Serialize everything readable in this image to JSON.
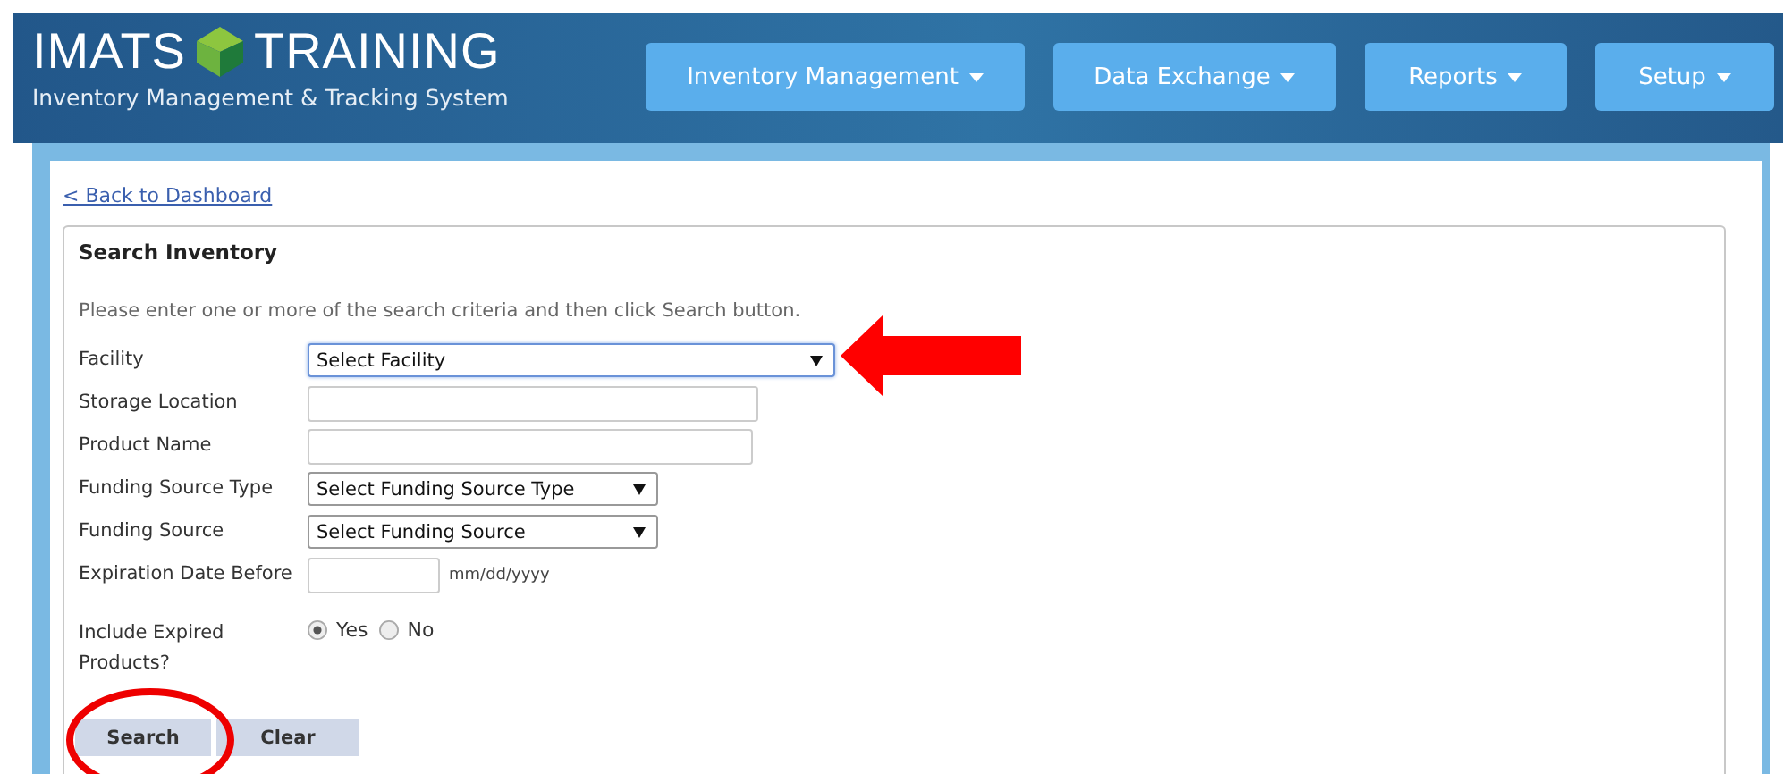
{
  "header": {
    "title_left": "IMATS",
    "title_right": "TRAINING",
    "subtitle": "Inventory Management & Tracking System"
  },
  "nav": [
    {
      "label": "Inventory Management"
    },
    {
      "label": "Data Exchange"
    },
    {
      "label": "Reports"
    },
    {
      "label": "Setup"
    }
  ],
  "back_link": "< Back to Dashboard",
  "panel": {
    "title": "Search Inventory",
    "instructions": "Please enter one or more of the search criteria and then click Search button.",
    "fields": [
      {
        "kind": "select",
        "label": "Facility",
        "value": "Select Facility",
        "focused": true
      },
      {
        "kind": "text",
        "label": "Storage Location"
      },
      {
        "kind": "text",
        "label": "Product Name"
      },
      {
        "kind": "select",
        "label": "Funding Source Type",
        "value": "Select Funding Source Type",
        "focused": false
      },
      {
        "kind": "select",
        "label": "Funding Source",
        "value": "Select Funding Source",
        "focused": false
      },
      {
        "kind": "date",
        "label": "Expiration Date Before",
        "hint": "mm/dd/yyyy"
      },
      {
        "kind": "radio",
        "label": "Include Expired Products?",
        "options": [
          {
            "label": "Yes",
            "selected": true
          },
          {
            "label": "No",
            "selected": false
          }
        ]
      }
    ],
    "buttons": [
      "Search",
      "Clear"
    ]
  }
}
